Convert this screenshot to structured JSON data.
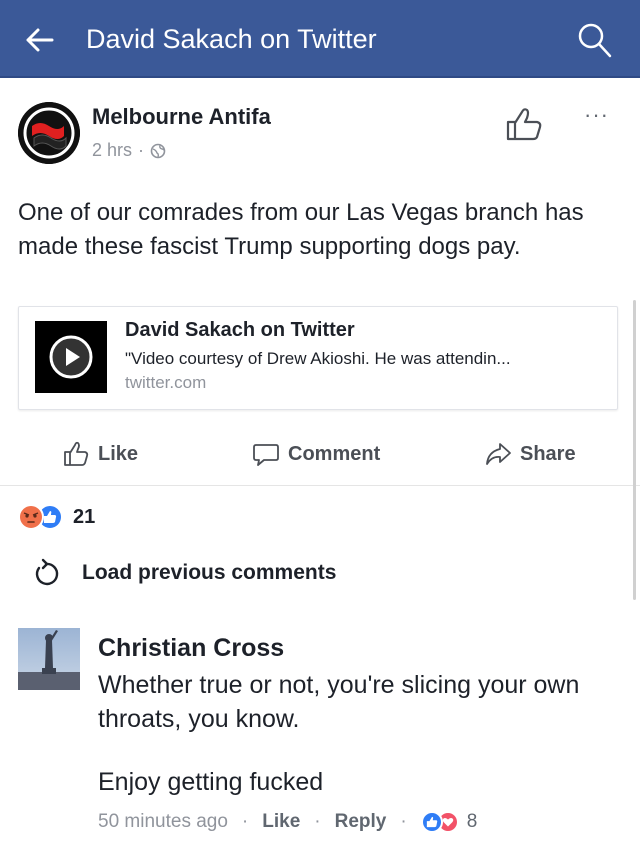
{
  "header": {
    "title": "David Sakach on Twitter",
    "back_icon": "back-arrow-icon",
    "search_icon": "search-icon",
    "color": "#3b5998"
  },
  "post": {
    "page_name": "Melbourne Antifa",
    "time": "2 hrs",
    "privacy_icon": "globe-icon",
    "text": "One of our comrades from our Las Vegas branch has made these fascist Trump supporting dogs pay.",
    "link": {
      "title": "David Sakach on Twitter",
      "description": "\"Video courtesy of Drew Akioshi. He was attendin...",
      "domain": "twitter.com",
      "thumb_icon": "play-icon"
    },
    "actions": {
      "like": "Like",
      "comment": "Comment",
      "share": "Share"
    },
    "reactions": {
      "types": [
        "angry",
        "like"
      ],
      "count": "21"
    }
  },
  "comments": {
    "load_previous": "Load previous comments",
    "items": [
      {
        "author": "Christian Cross",
        "text": "Whether true or not, you're slicing your own throats, you know.",
        "text2": "Enjoy getting fucked",
        "time": "50 minutes ago",
        "like_label": "Like",
        "reply_label": "Reply",
        "reactions": [
          "like",
          "love"
        ],
        "reaction_count": "8"
      }
    ]
  }
}
